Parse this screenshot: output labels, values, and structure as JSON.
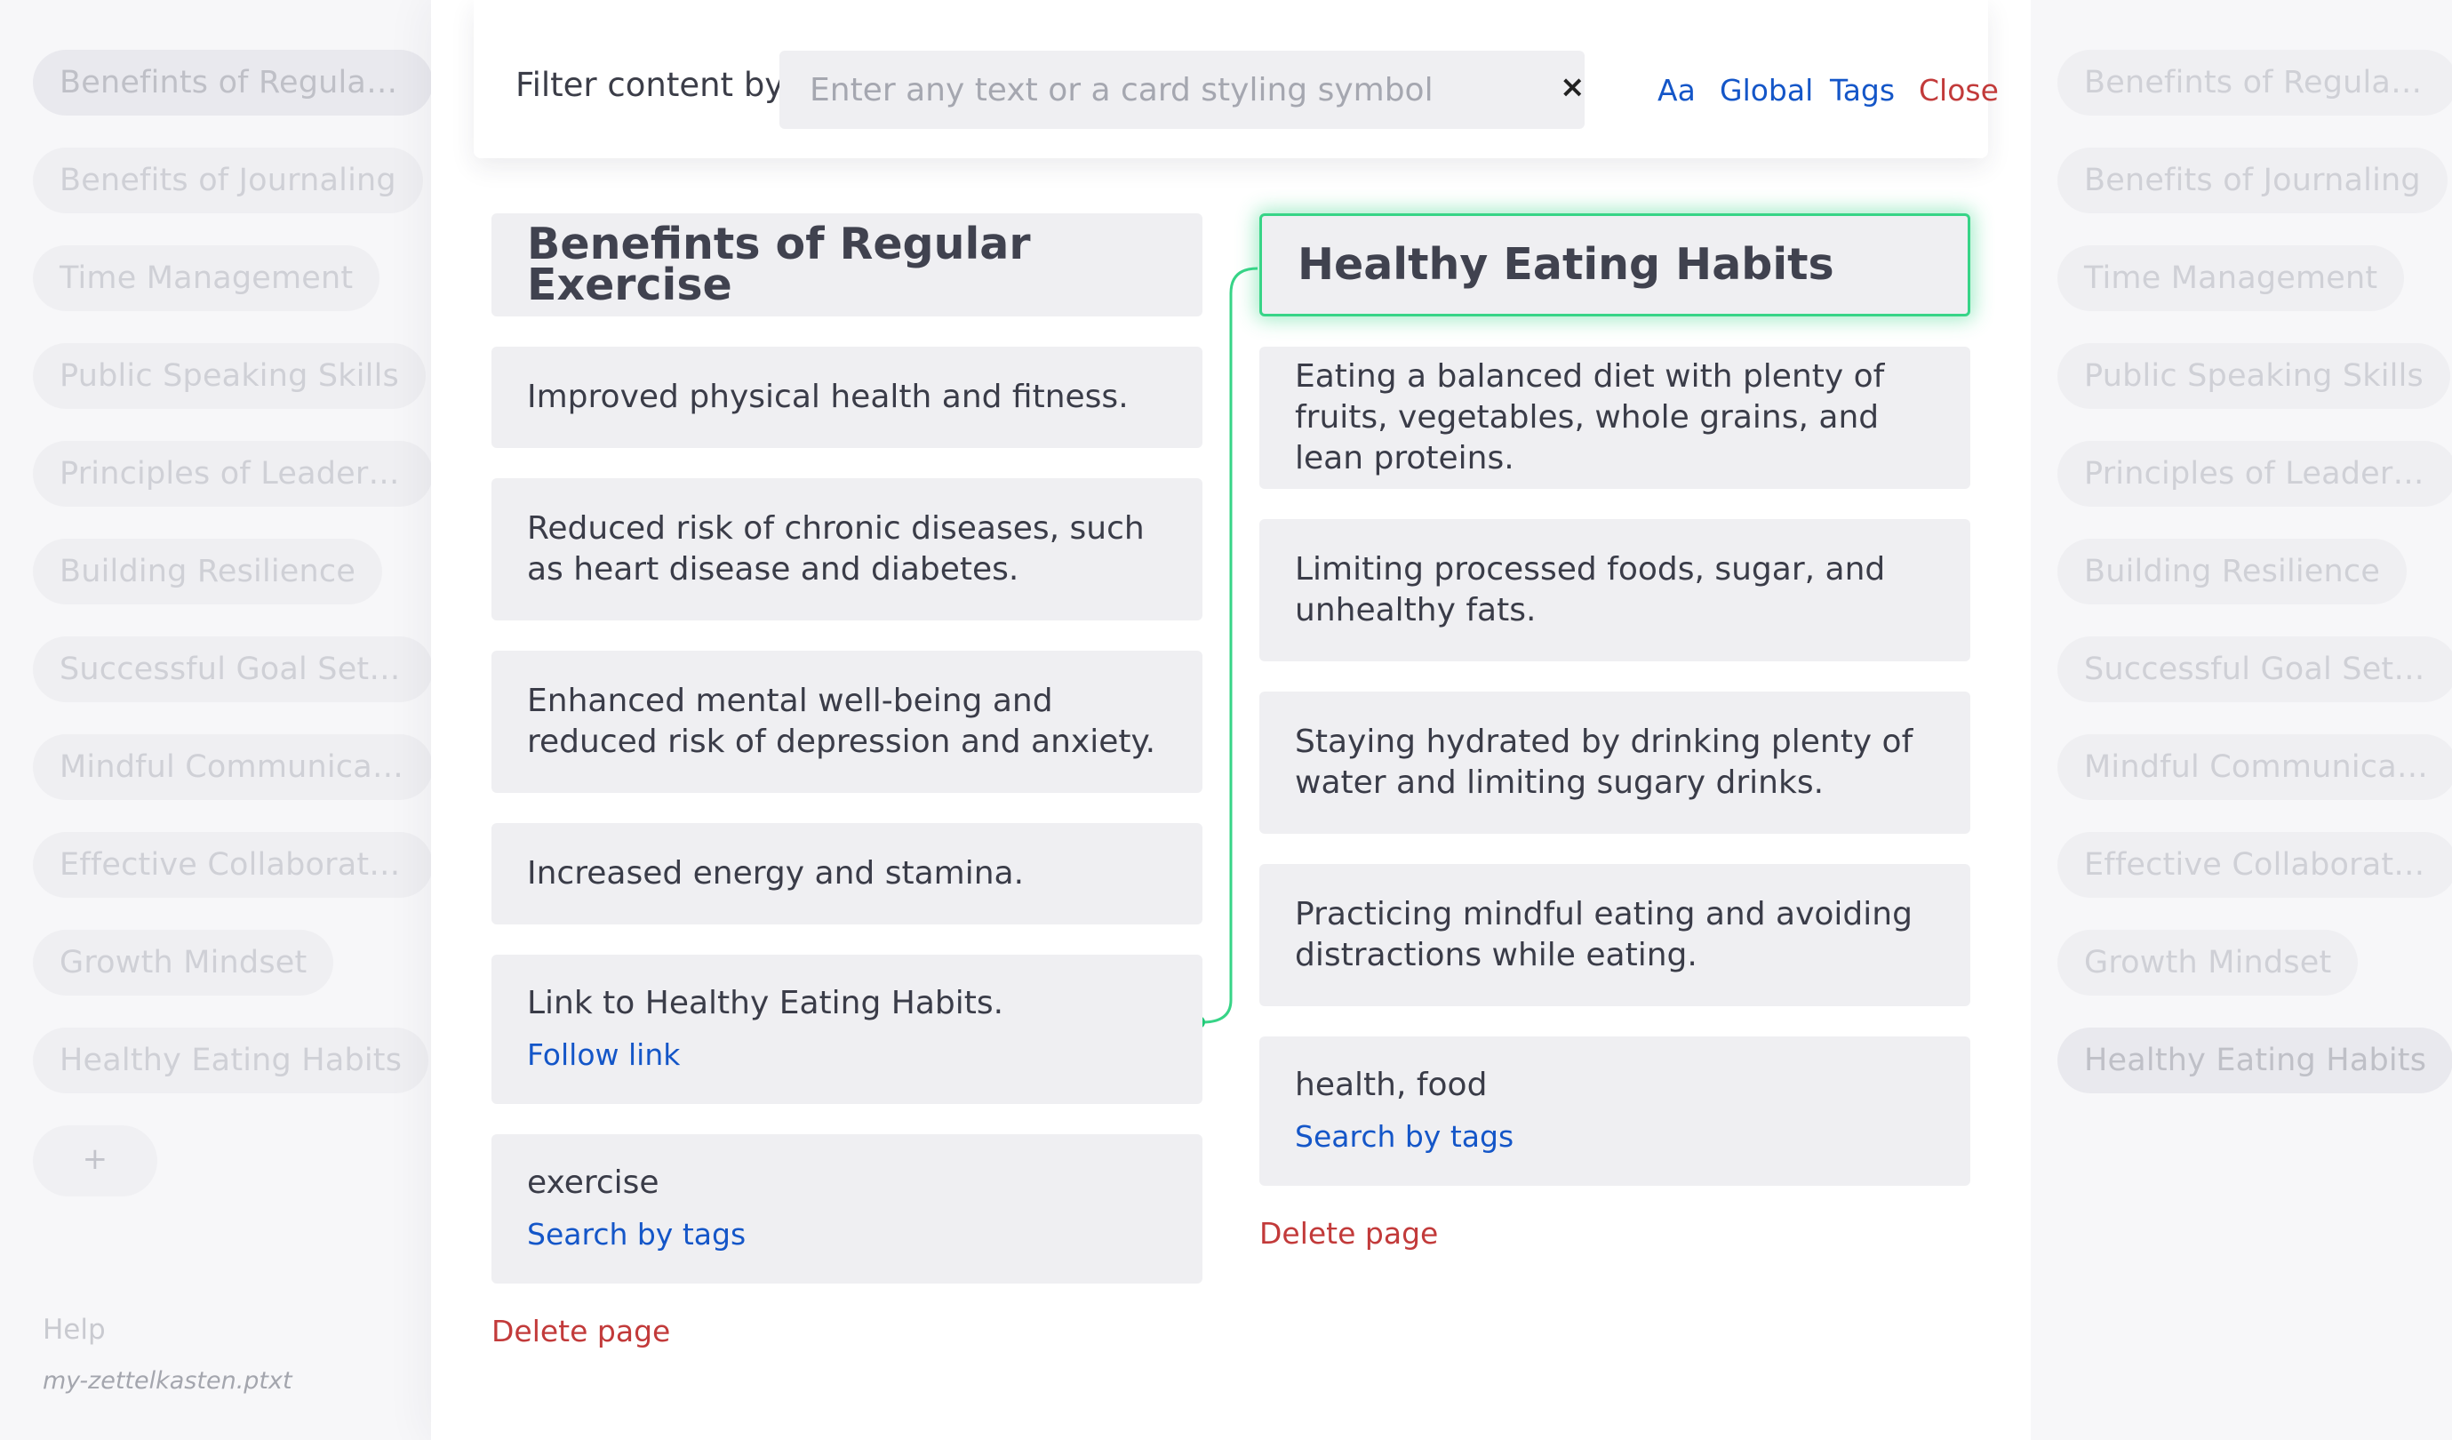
{
  "sidebar_left": {
    "pages": [
      {
        "label": "Benefints of Regular Exercise",
        "active": true
      },
      {
        "label": "Benefits of Journaling"
      },
      {
        "label": "Time Management"
      },
      {
        "label": "Public Speaking Skills"
      },
      {
        "label": "Principles of Leadership"
      },
      {
        "label": "Building Resilience"
      },
      {
        "label": "Successful Goal Setting"
      },
      {
        "label": "Mindful Communication"
      },
      {
        "label": "Effective Collaboration"
      },
      {
        "label": "Growth Mindset"
      },
      {
        "label": "Healthy Eating Habits"
      }
    ],
    "add_label": "+",
    "help": "Help",
    "filename": "my-zettelkasten.ptxt"
  },
  "sidebar_right": {
    "pages": [
      {
        "label": "Benefints of Regular Exercise"
      },
      {
        "label": "Benefits of Journaling"
      },
      {
        "label": "Time Management"
      },
      {
        "label": "Public Speaking Skills"
      },
      {
        "label": "Principles of Leadership"
      },
      {
        "label": "Building Resilience"
      },
      {
        "label": "Successful Goal Setting"
      },
      {
        "label": "Mindful Communication"
      },
      {
        "label": "Effective Collaboration"
      },
      {
        "label": "Growth Mindset"
      },
      {
        "label": "Healthy Eating Habits",
        "active": true
      }
    ]
  },
  "filter": {
    "label": "Filter content by",
    "placeholder": "Enter any text or a card styling symbol",
    "clear": "×",
    "case_toggle": "Aa",
    "global": "Global",
    "tags": "Tags",
    "close": "Close"
  },
  "left_page": {
    "title": "Benefints of Regular Exercise",
    "cards": [
      "Improved physical health and fitness.",
      "Reduced risk of chronic diseases, such as heart disease and diabetes.",
      "Enhanced mental well-being and reduced risk of depression and anxiety.",
      "Increased energy and stamina."
    ],
    "link_text": "Link to Healthy Eating Habits.",
    "follow_link": "Follow link",
    "tags": "exercise",
    "search_tags": "Search by tags",
    "delete": "Delete page"
  },
  "right_page": {
    "title": "Healthy Eating Habits",
    "cards": [
      "Eating a balanced diet with plenty of fruits, vegetables, whole grains, and lean proteins.",
      "Limiting processed foods, sugar, and unhealthy fats.",
      "Staying hydrated by drinking plenty of water and limiting sugary drinks.",
      "Practicing mindful eating and avoiding distractions while eating."
    ],
    "tags": "health, food",
    "search_tags": "Search by tags",
    "delete": "Delete page"
  },
  "colors": {
    "accent": "#1456c8",
    "danger": "#c23a3a",
    "highlight": "#37d487"
  }
}
